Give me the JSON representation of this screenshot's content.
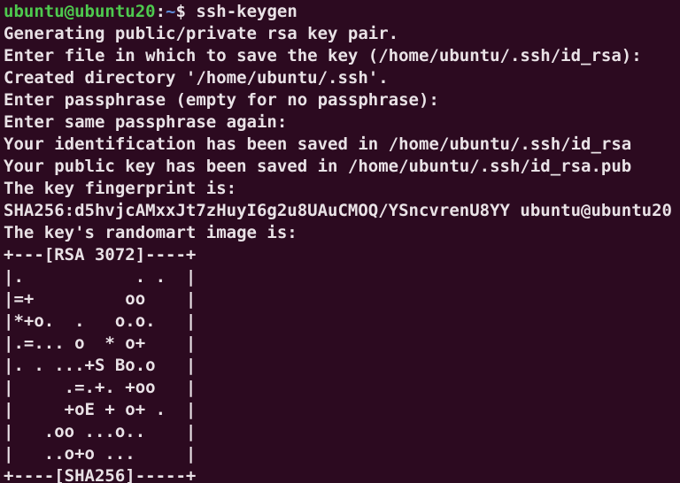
{
  "terminal": {
    "app": "terminal-window",
    "background_color": "#2c0a20",
    "foreground_color": "#e9e2e6",
    "prompt_user_host_color": "#4ec94e",
    "prompt_path_color": "#5f8ddb",
    "columns": 64,
    "rows": 22
  },
  "prompt": {
    "user_host": "ubuntu@ubuntu20",
    "colon": ":",
    "path": "~",
    "sigil": "$",
    "space": " ",
    "command": "ssh-keygen"
  },
  "output": {
    "line_generating": "Generating public/private rsa key pair.",
    "line_enter_file": "Enter file in which to save the key (/home/ubuntu/.ssh/id_rsa):",
    "line_created_dir": "Created directory '/home/ubuntu/.ssh'.",
    "line_enter_passphrase": "Enter passphrase (empty for no passphrase):",
    "line_same_passphrase": "Enter same passphrase again:",
    "line_identification_saved": "Your identification has been saved in /home/ubuntu/.ssh/id_rsa",
    "line_public_key_saved": "Your public key has been saved in /home/ubuntu/.ssh/id_rsa.pub",
    "line_fingerprint_label": "The key fingerprint is:",
    "line_fingerprint_value": "SHA256:d5hvjcAMxxJt7zHuyI6g2u8UAuCMOQ/YSncvrenU8YY ubuntu@ubuntu20",
    "line_randomart_label": "The key's randomart image is:"
  },
  "randomart": {
    "header": "+---[RSA 3072]----+",
    "footer": "+----[SHA256]-----+",
    "key_type": "RSA",
    "key_bits": "3072",
    "hash_algorithm": "SHA256",
    "rows": [
      "|.           . .  |",
      "|=+         oo    |",
      "|*+o.  .   o.o.   |",
      "|.=... o  * o+    |",
      "|. . ...+S Bo.o   |",
      "|     .=.+. +oo   |",
      "|     +oE + o+ .  |",
      "|   .oo ...o..    |",
      "|   ..o+o ...     |"
    ]
  }
}
